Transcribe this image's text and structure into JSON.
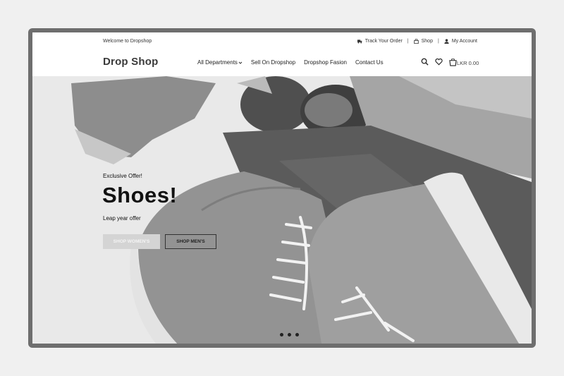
{
  "topbar": {
    "welcome": "Welcome to Dropshop",
    "track_order": "Track Your Order",
    "shop": "Shop",
    "my_account": "My Account",
    "separator": "|"
  },
  "header": {
    "logo": "Drop Shop",
    "nav": [
      "All Departments",
      "Sell On Dropshop",
      "Dropshop Fasion",
      "Contact Us"
    ],
    "cart_amount": "LKR 0.00"
  },
  "hero": {
    "kicker": "Exclusive Offer!",
    "headline": "Shoes!",
    "sub": "Leap year offer",
    "btn_women": "SHOP WOMEN'S",
    "btn_men": "SHOP MEN'S",
    "slides": 3,
    "active_slide": 1
  },
  "icons": [
    "truck-icon",
    "bag-icon",
    "user-icon",
    "search-icon",
    "heart-icon",
    "cart-icon",
    "chevron-down-icon"
  ],
  "colors": {
    "frame": "#6e6e6e",
    "text": "#222222",
    "button_women_bg": "#d4d4d4"
  }
}
